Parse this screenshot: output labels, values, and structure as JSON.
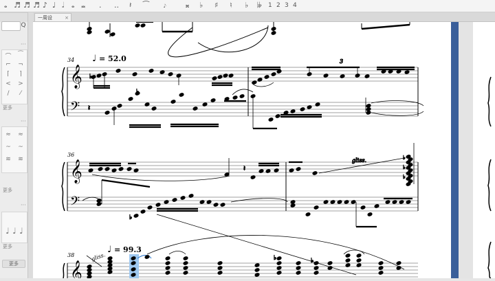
{
  "toolbar": {
    "digits": [
      "1",
      "2",
      "3",
      "4"
    ]
  },
  "tab": {
    "label": "一周设",
    "close": "×"
  },
  "palette": {
    "search_button": "Q",
    "more_label_1": "更多",
    "more_label_2": "更多",
    "more_label_3": "更多",
    "button_label": "更多"
  },
  "score": {
    "measure_numbers": [
      "34",
      "36",
      "38"
    ],
    "tempo_1": "= 52.0",
    "tempo_2": "= 99.3",
    "tuplet": "3",
    "gliss_1": "gliss.",
    "gliss_2": "gliss."
  },
  "colors": {
    "accent_bar": "#3a5f9a",
    "selection": "#9ec8f0"
  }
}
